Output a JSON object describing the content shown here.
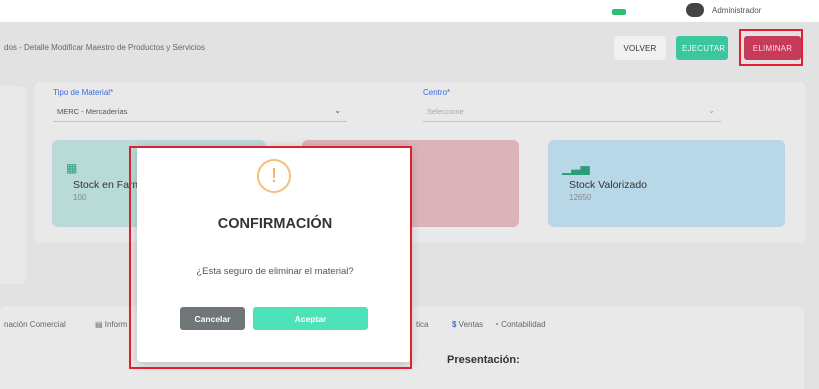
{
  "user": {
    "name": "Administrador"
  },
  "breadcrumb": "dos - Detalle Modificar Maestro de Productos y Servicios",
  "toolbar": {
    "volver": "VOLVER",
    "ejecutar": "EJECUTAR",
    "eliminar": "ELIMINAR"
  },
  "form": {
    "tipo_material_label": "Tipo de Material*",
    "tipo_material_value": "MERC - Mercaderías",
    "centro_label": "Centro*",
    "centro_placeholder": "Seleccione"
  },
  "stats": [
    {
      "title": "Stock en Farm",
      "value": "100"
    },
    {
      "title": "",
      "value": ""
    },
    {
      "title": "Stock Valorizado",
      "value": "12650"
    }
  ],
  "tabs": [
    "nación Comercial",
    "Inform",
    "tica",
    "Ventas",
    "Contabilidad"
  ],
  "section": {
    "title": "Presentación:"
  },
  "modal": {
    "title": "CONFIRMACIÓN",
    "message": "¿Esta seguro de eliminar el material?",
    "cancel": "Cancelar",
    "accept": "Aceptar"
  },
  "colors": {
    "accent_green": "#3bc6a0",
    "danger": "#c63b5a",
    "annotation_red": "#e02030"
  }
}
